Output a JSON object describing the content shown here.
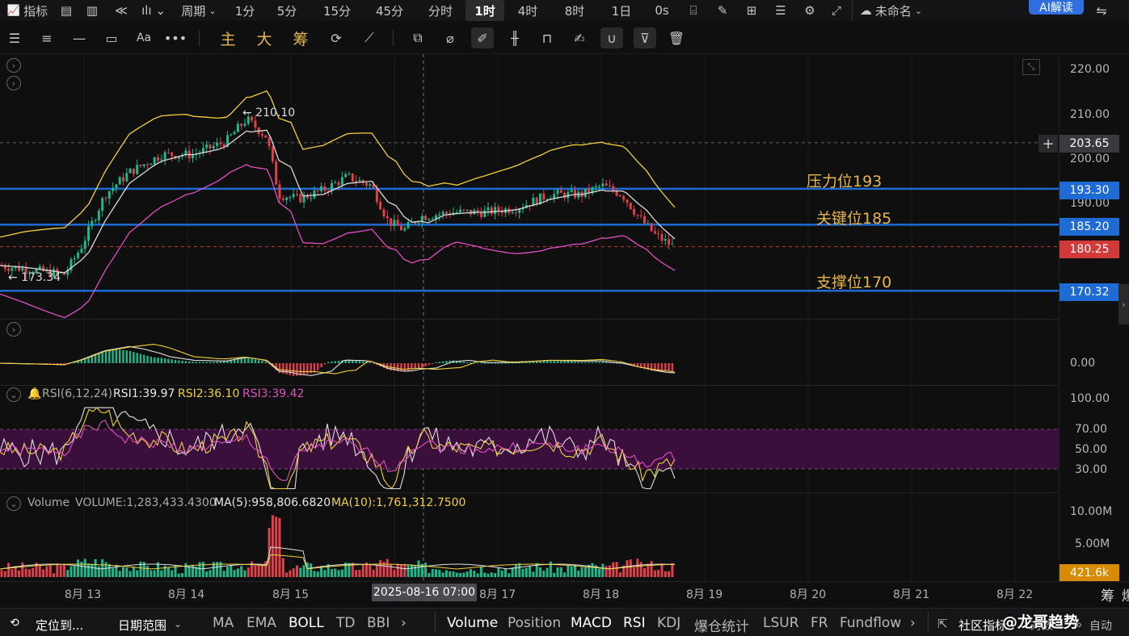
{
  "topbar": {
    "indicator_label": "指标",
    "period_label": "周期",
    "intervals": [
      "1分",
      "5分",
      "15分",
      "45分",
      "分时",
      "1时",
      "4时",
      "8时",
      "1日",
      "0s"
    ],
    "active_interval": "1时",
    "layout_name": "未命名",
    "ai_button": "AI解读"
  },
  "toolbar": {
    "chip_zhu": "主",
    "chip_da": "大",
    "chip_chou": "筹"
  },
  "price_axis": {
    "ticks": [
      "220.00",
      "210.00",
      "200.00",
      "190.00",
      "180.00"
    ],
    "crosshair_price": "203.65",
    "levels": [
      {
        "price": "193.30",
        "color": "#1f6bd6"
      },
      {
        "price": "185.20",
        "color": "#1f6bd6"
      },
      {
        "price": "180.25",
        "color": "#d23a3a"
      },
      {
        "price": "170.32",
        "color": "#1f6bd6"
      }
    ]
  },
  "annotations": {
    "resistance": "压力位193",
    "key": "关键位185",
    "support": "支撑位170",
    "high_label": "← 210.10",
    "low_label": "← 173.34"
  },
  "macd_pane": {
    "zero": "0.00"
  },
  "rsi_pane": {
    "name": "RSI(6,12,24)",
    "rsi1": "RSI1:39.97",
    "rsi2": "RSI2:36.10",
    "rsi3": "RSI3:39.42",
    "ticks": [
      "100.00",
      "70.00",
      "50.00",
      "30.00"
    ],
    "colors": {
      "rsi1": "#e0e0e0",
      "rsi2": "#f0d040",
      "rsi3": "#e050c0"
    }
  },
  "volume_pane": {
    "name": "Volume",
    "volume": "VOLUME:1,283,433.4300",
    "ma5": "MA(5):958,806.6820",
    "ma10": "MA(10):1,761,312.7500",
    "ticks": [
      "10.00M",
      "5.00M"
    ],
    "current": "421.6k"
  },
  "x_axis": {
    "labels": [
      "8月 13",
      "8月 14",
      "8月 15",
      "8月 17",
      "8月 18",
      "8月 19",
      "8月 20",
      "8月 21",
      "8月 22"
    ],
    "crosshair_time": "2025-08-16 07:00",
    "right_tools": [
      "筹",
      "爆"
    ]
  },
  "bottom": {
    "locate": "定位到...",
    "date_range": "日期范围",
    "main_indicators": [
      "MA",
      "EMA",
      "BOLL",
      "TD",
      "BBI"
    ],
    "sub_indicators": [
      "Volume",
      "Position",
      "MACD",
      "RSI",
      "KDJ",
      "爆仓统计",
      "LSUR",
      "FR",
      "Fundflow"
    ],
    "community": "社区指标",
    "log_label": "对数",
    "pct_label": "%",
    "auto_label": "自动",
    "watermark": "@龙哥趋势"
  },
  "colors": {
    "up": "#1fb88a",
    "down": "#e0404a",
    "boll_upper": "#f0d040",
    "boll_mid": "#d8d8d8",
    "boll_lower": "#e050c0",
    "level": "#1f6bd6",
    "accent": "#e6b64c"
  }
}
